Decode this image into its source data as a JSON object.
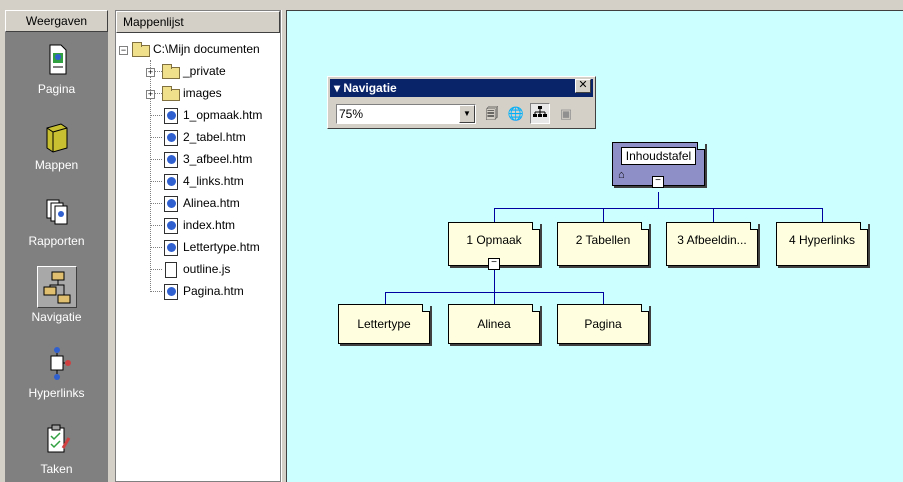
{
  "views": {
    "header": "Weergaven",
    "items": [
      {
        "label": "Pagina",
        "icon": "page-icon"
      },
      {
        "label": "Mappen",
        "icon": "folder-icon"
      },
      {
        "label": "Rapporten",
        "icon": "reports-icon"
      },
      {
        "label": "Navigatie",
        "icon": "navigation-icon",
        "active": true
      },
      {
        "label": "Hyperlinks",
        "icon": "hyperlinks-icon"
      },
      {
        "label": "Taken",
        "icon": "tasks-icon"
      }
    ]
  },
  "folders": {
    "header": "Mappenlijst",
    "root": "C:\\Mijn documenten",
    "items": [
      {
        "name": "_private",
        "type": "folder"
      },
      {
        "name": "images",
        "type": "folder"
      },
      {
        "name": "1_opmaak.htm",
        "type": "page"
      },
      {
        "name": "2_tabel.htm",
        "type": "page"
      },
      {
        "name": "3_afbeel.htm",
        "type": "page"
      },
      {
        "name": "4_links.htm",
        "type": "page"
      },
      {
        "name": "Alinea.htm",
        "type": "page"
      },
      {
        "name": "index.htm",
        "type": "page"
      },
      {
        "name": "Lettertype.htm",
        "type": "page"
      },
      {
        "name": "outline.js",
        "type": "file"
      },
      {
        "name": "Pagina.htm",
        "type": "page"
      }
    ]
  },
  "navbar": {
    "title": "Navigatie",
    "zoom": "75%"
  },
  "nav_tree": {
    "root": "Inhoudstafel",
    "level1": [
      "1 Opmaak",
      "2 Tabellen",
      "3 Afbeeldin...",
      "4 Hyperlinks"
    ],
    "level2": [
      "Lettertype",
      "Alinea",
      "Pagina"
    ]
  },
  "colors": {
    "pane_background": "#ccffff",
    "node_background": "#ffffe0",
    "root_node": "#8f8fc8",
    "connector": "#0000a0",
    "title_bar": "#0a246a"
  }
}
